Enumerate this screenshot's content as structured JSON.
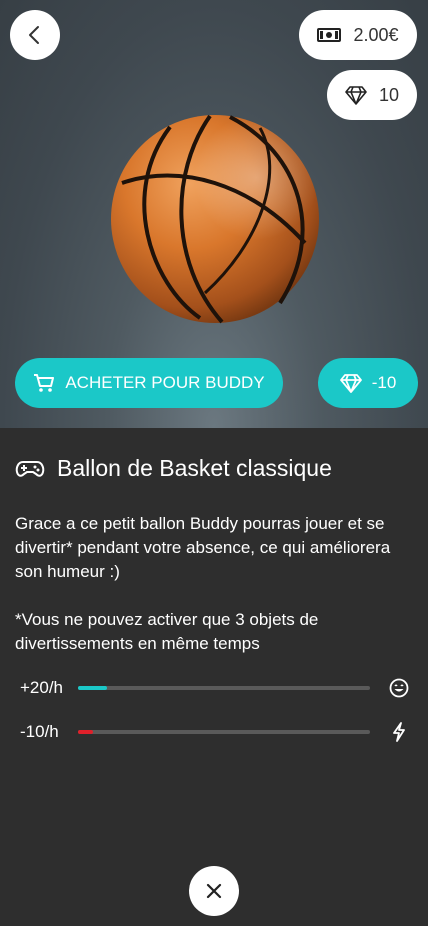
{
  "header": {
    "currency": {
      "icon": "banknote-icon",
      "value": "2.00€"
    },
    "gems": {
      "icon": "diamond-icon",
      "value": "10"
    }
  },
  "actions": {
    "buy_label": "ACHETER POUR BUDDY",
    "gem_cost": "-10"
  },
  "item": {
    "icon": "gamepad-icon",
    "title": "Ballon de Basket classique",
    "description": "Grace a ce petit ballon Buddy pourras jouer et se divertir* pendant votre absence, ce qui améliorera son humeur :)",
    "note": "*Vous ne pouvez activer que 3 objets de divertissements en même temps"
  },
  "stats": [
    {
      "label": "+20/h",
      "level": 0.1,
      "color": "#1bc8c8",
      "icon": "smile-icon"
    },
    {
      "label": "-10/h",
      "level": 0.05,
      "color": "#e0202a",
      "icon": "lightning-icon"
    }
  ]
}
